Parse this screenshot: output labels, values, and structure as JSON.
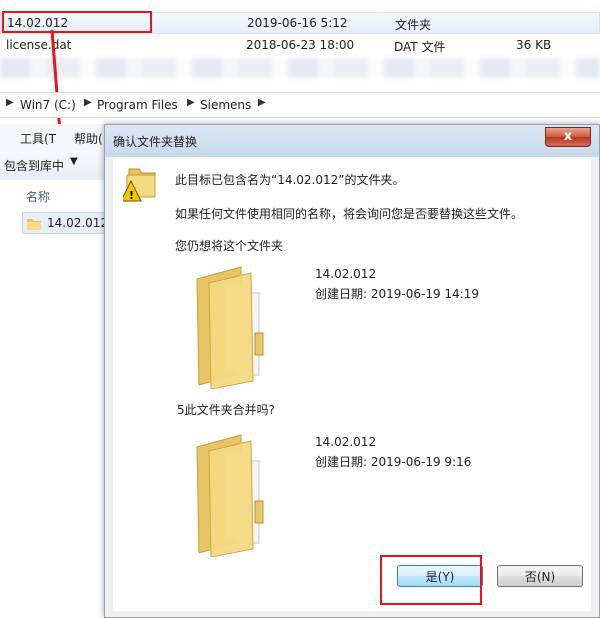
{
  "file_list": {
    "rows": [
      {
        "name": "14.02.012",
        "date": "2019-06-16 5:12",
        "type": "文件夹",
        "size": ""
      },
      {
        "name": "license.dat",
        "date": "2018-06-23 18:00",
        "type": "DAT 文件",
        "size": "36 KB"
      }
    ]
  },
  "address_bar": {
    "crumbs": [
      "Win7 (C:)",
      "Program Files",
      "Siemens"
    ]
  },
  "explorer": {
    "menu_tools": "工具(T",
    "menu_help": "帮助(",
    "toolbar_include": "包含到库中",
    "column_name": "名称",
    "folder_item": "14.02.012"
  },
  "dialog": {
    "title": "确认文件夹替换",
    "close_glyph": "x",
    "message_main": "此目标已包含名为“14.02.012”的文件夹。",
    "message_detail": "如果任何文件使用相同的名称，将会询问您是否要替换这些文件。",
    "message_question": "您仍想将这个文件夹",
    "existing": {
      "name": "14.02.012",
      "created": "创建日期: 2019-06-19 14:19"
    },
    "merge_question": "5此文件夹合并吗?",
    "incoming": {
      "name": "14.02.012",
      "created": "创建日期: 2019-06-19 9:16"
    },
    "yes_button": "是(Y)",
    "no_button": "否(N)"
  },
  "colors": {
    "highlight": "#e8141b",
    "folder_yellow": "#f3d27a",
    "dialog_title_bg": "#c8d8ec"
  }
}
